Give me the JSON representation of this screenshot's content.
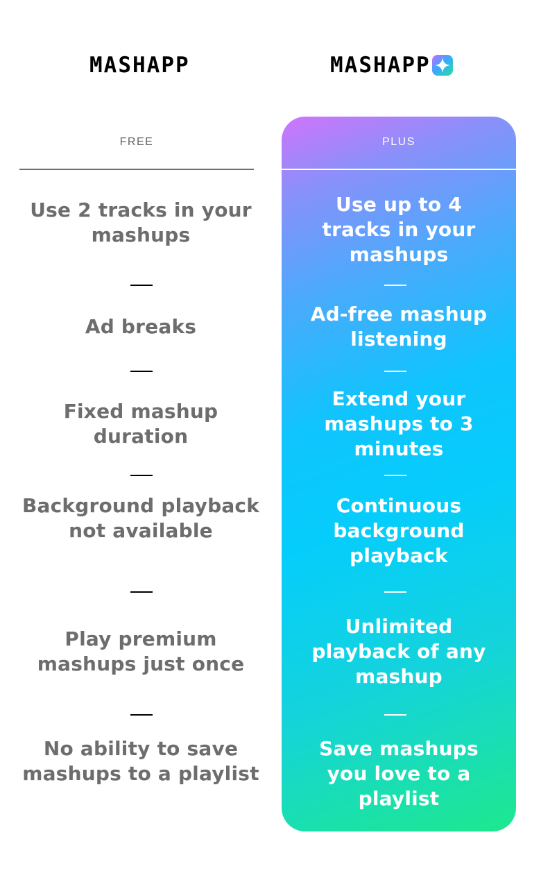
{
  "brand": {
    "free_logo": "MASHAPP",
    "plus_logo": "MASHAPP",
    "plus_badge_icon": "sparkle-plus-icon"
  },
  "columns": {
    "free_label": "FREE",
    "plus_label": "PLUS"
  },
  "features": [
    {
      "free": "Use 2 tracks in your mashups",
      "plus": "Use up to 4 tracks in your mashups"
    },
    {
      "free": "Ad breaks",
      "plus": "Ad-free mashup listening"
    },
    {
      "free": "Fixed mashup duration",
      "plus": "Extend your mashups to 3 minutes"
    },
    {
      "free": "Background playback not available",
      "plus": "Continuous background playback"
    },
    {
      "free": "Play premium mashups just once",
      "plus": "Unlimited playback of any mashup"
    },
    {
      "free": "No ability to save mashups to a playlist",
      "plus": "Save mashups you love to a playlist"
    }
  ],
  "colors": {
    "free_text": "#6d6d6d",
    "plus_text": "#ffffff",
    "gradient_top": "#cf74fb",
    "gradient_mid": "#05cdfb",
    "gradient_bottom": "#1ee88e"
  }
}
